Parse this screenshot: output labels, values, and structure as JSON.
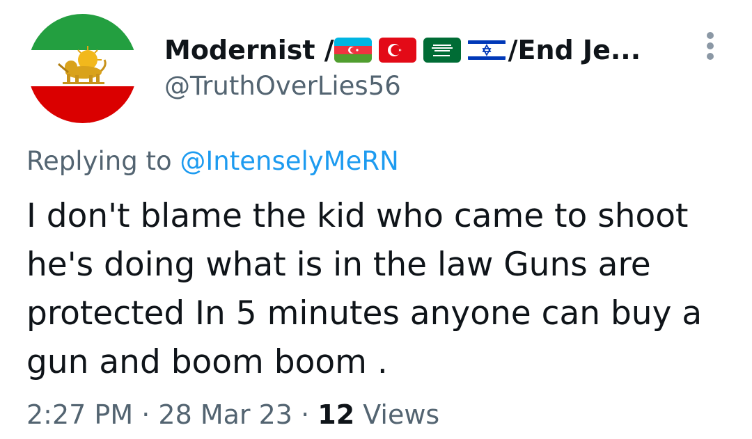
{
  "author": {
    "display_name_prefix": "Modernist / ",
    "flags": [
      "azerbaijan-flag",
      "turkey-flag",
      "saudi-arabia-flag",
      "israel-flag"
    ],
    "display_name_suffix": "/End Je...",
    "handle": "@TruthOverLies56",
    "avatar": "iran-lion-and-sun-flag"
  },
  "reply": {
    "prefix": "Replying to",
    "mention": "@IntenselyMeRN"
  },
  "tweet": {
    "lines": [
      "I don't blame the kid who came to shoot",
      "he's doing what is in the law Guns are",
      "protected In 5 minutes anyone can buy a",
      "gun and boom boom ."
    ]
  },
  "meta": {
    "time": "2:27 PM",
    "separator": "·",
    "date": "28 Mar 23",
    "views_count": "12",
    "views_label": "Views"
  },
  "colors": {
    "text_primary": "#0f1419",
    "text_secondary": "#536471",
    "link": "#1d9bf0"
  }
}
